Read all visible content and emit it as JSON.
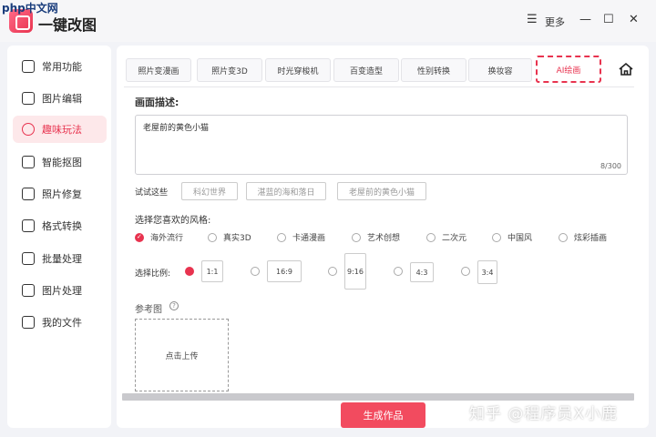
{
  "app": {
    "php_mark": "php中文网",
    "title": "一键改图",
    "more_label": "更多",
    "menu_glyph": "☰",
    "minimize_glyph": "—",
    "maximize_glyph": "☐",
    "close_glyph": "✕"
  },
  "sidebar": {
    "items": [
      {
        "label": "常用功能",
        "icon": "grid-icon"
      },
      {
        "label": "图片编辑",
        "icon": "edit-icon"
      },
      {
        "label": "趣味玩法",
        "icon": "fun-icon",
        "active": true
      },
      {
        "label": "智能抠图",
        "icon": "cutout-icon"
      },
      {
        "label": "照片修复",
        "icon": "repair-icon"
      },
      {
        "label": "格式转换",
        "icon": "convert-icon"
      },
      {
        "label": "批量处理",
        "icon": "layers-icon"
      },
      {
        "label": "图片处理",
        "icon": "image-icon"
      },
      {
        "label": "我的文件",
        "icon": "folder-icon"
      }
    ]
  },
  "tabs": [
    {
      "label": "照片变漫画"
    },
    {
      "label": "照片变3D"
    },
    {
      "label": "时光穿梭机"
    },
    {
      "label": "百变造型"
    },
    {
      "label": "性别转换"
    },
    {
      "label": "换妆容"
    },
    {
      "label": "AI绘画",
      "active": true
    }
  ],
  "form": {
    "description_label": "画面描述:",
    "description_value": "老屋前的黄色小猫",
    "counter": "8/300",
    "try_label": "试试这些",
    "suggestions": [
      "科幻世界",
      "湛蓝的海和落日",
      "老屋前的黄色小猫"
    ],
    "style_label": "选择您喜欢的风格:",
    "styles": [
      {
        "label": "海外流行",
        "selected": true
      },
      {
        "label": "真实3D"
      },
      {
        "label": "卡通漫画"
      },
      {
        "label": "艺术创想"
      },
      {
        "label": "二次元"
      },
      {
        "label": "中国风"
      },
      {
        "label": "炫彩插画"
      }
    ],
    "ratio_label": "选择比例:",
    "ratios": [
      {
        "label": "1:1",
        "selected": true
      },
      {
        "label": "16:9"
      },
      {
        "label": "9:16"
      },
      {
        "label": "4:3"
      },
      {
        "label": "3:4"
      }
    ],
    "reference_label": "参考图",
    "upload_label": "点击上传",
    "generate_label": "生成作品"
  },
  "watermark": "知乎 @程序员X小鹿",
  "colors": {
    "accent": "#e8334f",
    "button": "#f24b5f"
  }
}
